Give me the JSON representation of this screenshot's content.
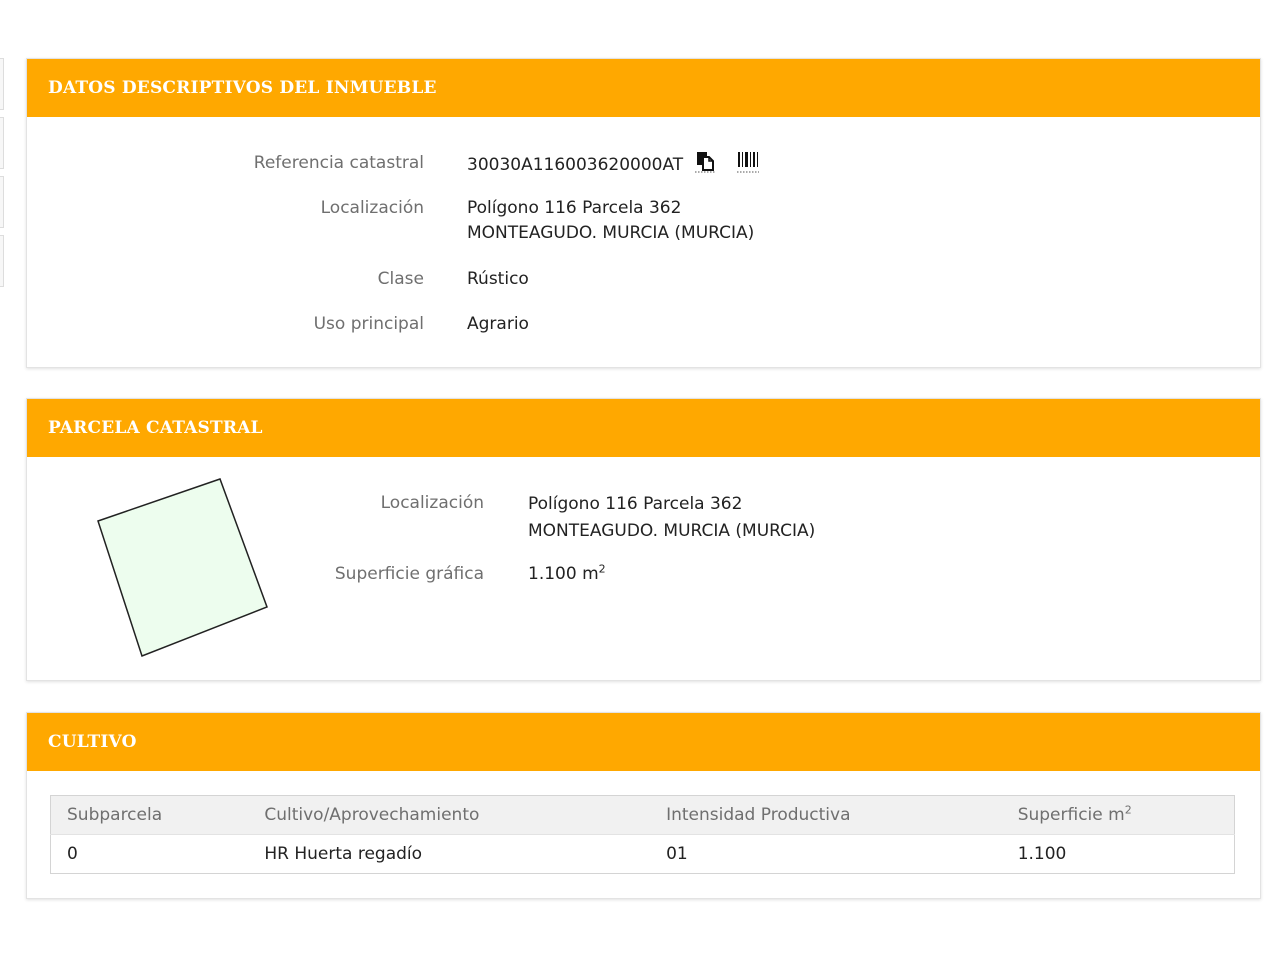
{
  "descriptivos": {
    "title": "DATOS DESCRIPTIVOS DEL INMUEBLE",
    "referencia_label": "Referencia catastral",
    "referencia_value": "30030A116003620000AT",
    "copy_icon": "copy-icon",
    "barcode_icon": "barcode-icon",
    "localizacion_label": "Localización",
    "localizacion_line1": "Polígono 116 Parcela 362",
    "localizacion_line2": "MONTEAGUDO. MURCIA (MURCIA)",
    "clase_label": "Clase",
    "clase_value": "Rústico",
    "uso_label": "Uso principal",
    "uso_value": "Agrario"
  },
  "parcela": {
    "title": "PARCELA CATASTRAL",
    "localizacion_label": "Localización",
    "localizacion_line1": "Polígono 116 Parcela 362",
    "localizacion_line2": "MONTEAGUDO. MURCIA (MURCIA)",
    "superficie_label": "Superficie gráfica",
    "superficie_value": "1.100 m",
    "superficie_sup": "2",
    "plot_fill": "#edfdee",
    "plot_stroke": "#222222"
  },
  "cultivo": {
    "title": "CULTIVO",
    "headers": [
      "Subparcela",
      "Cultivo/Aprovechamiento",
      "Intensidad Productiva",
      "Superficie m"
    ],
    "header_sup": "2",
    "rows": [
      [
        "0",
        "HR Huerta regadío",
        "01",
        "1.100"
      ]
    ]
  },
  "colors": {
    "header_bg": "#ffa800",
    "header_text": "#ffffff",
    "label_text": "#6f6f6f"
  }
}
